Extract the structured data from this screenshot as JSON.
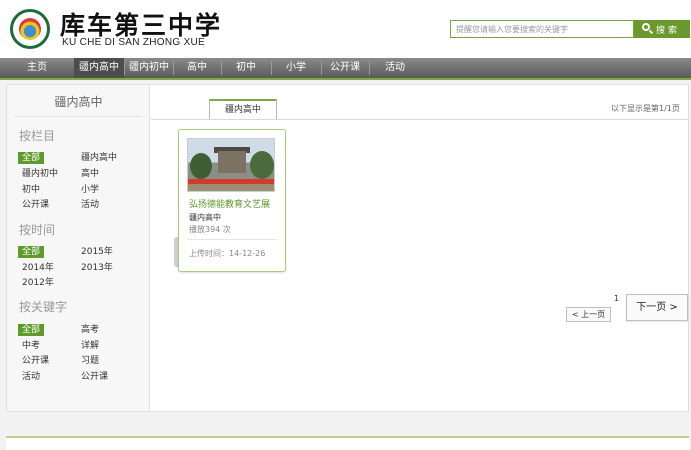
{
  "header": {
    "school_name": "库车第三中学",
    "school_name_en": "KU CHE DI SAN ZHONG XUE",
    "search_placeholder": "提醒您请输入您要搜索的关键字",
    "search_button": "搜索"
  },
  "nav": {
    "items": [
      "主页",
      "疆内高中",
      "疆内初中",
      "高中",
      "初中",
      "小学",
      "公开课",
      "活动"
    ],
    "active": "疆内高中"
  },
  "sidebar": {
    "title": "疆内高中",
    "by_column": {
      "heading": "按栏目",
      "tags": [
        "全部",
        "疆内高中",
        "疆内初中",
        "高中",
        "初中",
        "小学",
        "公开课",
        "活动"
      ],
      "selected": "全部"
    },
    "by_time": {
      "heading": "按时间",
      "tags": [
        "全部",
        "2015年",
        "2014年",
        "2013年",
        "2012年"
      ],
      "selected": "全部"
    },
    "by_keyword": {
      "heading": "按关键字",
      "tags": [
        "全部",
        "高考",
        "中考",
        "详解",
        "公开课",
        "习题",
        "活动",
        "公开课"
      ],
      "selected": "全部"
    }
  },
  "main": {
    "tab_label": "疆内高中",
    "page_info": "以下显示是第1/1页",
    "card": {
      "title": "弘扬德能教育文艺展",
      "category": "疆内高中",
      "plays": "播放394 次",
      "date": "上传时间：14-12-26"
    },
    "pagination": {
      "current": "1",
      "prev": "< 上一页",
      "next": "下一页 >"
    }
  },
  "colors": {
    "accent_green": "#5f9a2c",
    "nav_bg": "#6e6e6e"
  }
}
